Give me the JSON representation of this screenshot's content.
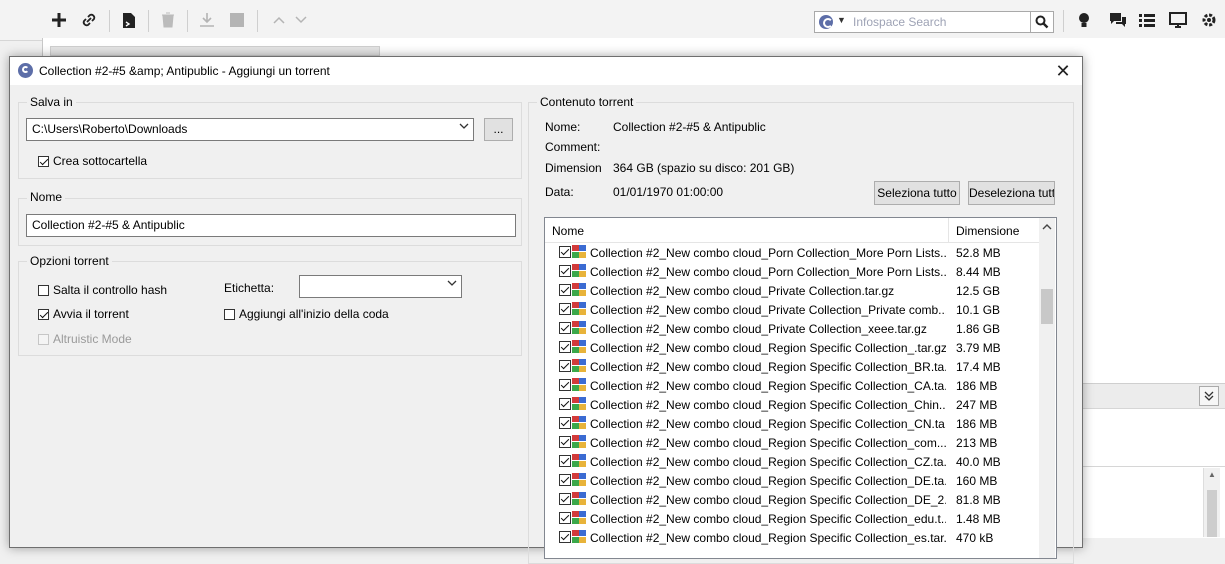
{
  "toolbar": {
    "search_placeholder": "Infospace Search",
    "icons": [
      "plus-icon",
      "link-icon",
      "file-icon",
      "trash-icon",
      "download-icon",
      "stop-icon",
      "arrow-up-icon",
      "arrow-down-icon",
      "search-icon",
      "bulb-icon",
      "chat-icon",
      "list-icon",
      "monitor-icon",
      "gear-icon"
    ]
  },
  "dialog": {
    "title": "Collection #2-#5 &amp; Antipublic - Aggiungi un torrent",
    "save_in": {
      "label": "Salva in",
      "path": "C:\\Users\\Roberto\\Downloads",
      "browse": "...",
      "subfolder": "Crea sottocartella",
      "subfolder_checked": true
    },
    "name_group": {
      "label": "Nome",
      "value": "Collection #2-#5 & Antipublic"
    },
    "options": {
      "label": "Opzioni torrent",
      "skip_hash": "Salta il controllo hash",
      "skip_hash_checked": false,
      "start": "Avvia il torrent",
      "start_checked": true,
      "altruistic": "Altruistic Mode",
      "altruistic_checked": false,
      "tag_label": "Etichetta:",
      "queue_top": "Aggiungi all'inizio della coda",
      "queue_top_checked": false
    },
    "content": {
      "label": "Contenuto torrent",
      "name_label": "Nome:",
      "name_value": "Collection #2-#5 & Antipublic",
      "comment_label": "Comment:",
      "size_label": "Dimension",
      "size_value": "364 GB (spazio su disco: 201 GB)",
      "date_label": "Data:",
      "date_value": "01/01/1970 01:00:00",
      "select_all": "Seleziona tutto",
      "deselect_all": "Deseleziona tutto"
    },
    "tree": {
      "col_name": "Nome",
      "col_size": "Dimensione",
      "files": [
        {
          "name": "Collection #2_New combo cloud_Porn Collection_More Porn Lists....",
          "size": "52.8 MB"
        },
        {
          "name": "Collection #2_New combo cloud_Porn Collection_More Porn Lists....",
          "size": "8.44 MB"
        },
        {
          "name": "Collection #2_New combo cloud_Private Collection.tar.gz",
          "size": "12.5 GB"
        },
        {
          "name": "Collection #2_New combo cloud_Private Collection_Private comb...",
          "size": "10.1 GB"
        },
        {
          "name": "Collection #2_New combo cloud_Private Collection_xeee.tar.gz",
          "size": "1.86 GB"
        },
        {
          "name": "Collection #2_New combo cloud_Region Specific Collection_.tar.gz",
          "size": "3.79 MB"
        },
        {
          "name": "Collection #2_New combo cloud_Region Specific Collection_BR.ta...",
          "size": "17.4 MB"
        },
        {
          "name": "Collection #2_New combo cloud_Region Specific Collection_CA.ta...",
          "size": "186 MB"
        },
        {
          "name": "Collection #2_New combo cloud_Region Specific Collection_Chin...",
          "size": "247 MB"
        },
        {
          "name": "Collection #2_New combo cloud_Region Specific Collection_CN.ta...",
          "size": "186 MB"
        },
        {
          "name": "Collection #2_New combo cloud_Region Specific Collection_com....",
          "size": "213 MB"
        },
        {
          "name": "Collection #2_New combo cloud_Region Specific Collection_CZ.ta...",
          "size": "40.0 MB"
        },
        {
          "name": "Collection #2_New combo cloud_Region Specific Collection_DE.ta...",
          "size": "160 MB"
        },
        {
          "name": "Collection #2_New combo cloud_Region Specific Collection_DE_2...",
          "size": "81.8 MB"
        },
        {
          "name": "Collection #2_New combo cloud_Region Specific Collection_edu.t...",
          "size": "1.48 MB"
        },
        {
          "name": "Collection #2_New combo cloud_Region Specific Collection_es.tar...",
          "size": "470 kB"
        }
      ]
    }
  }
}
